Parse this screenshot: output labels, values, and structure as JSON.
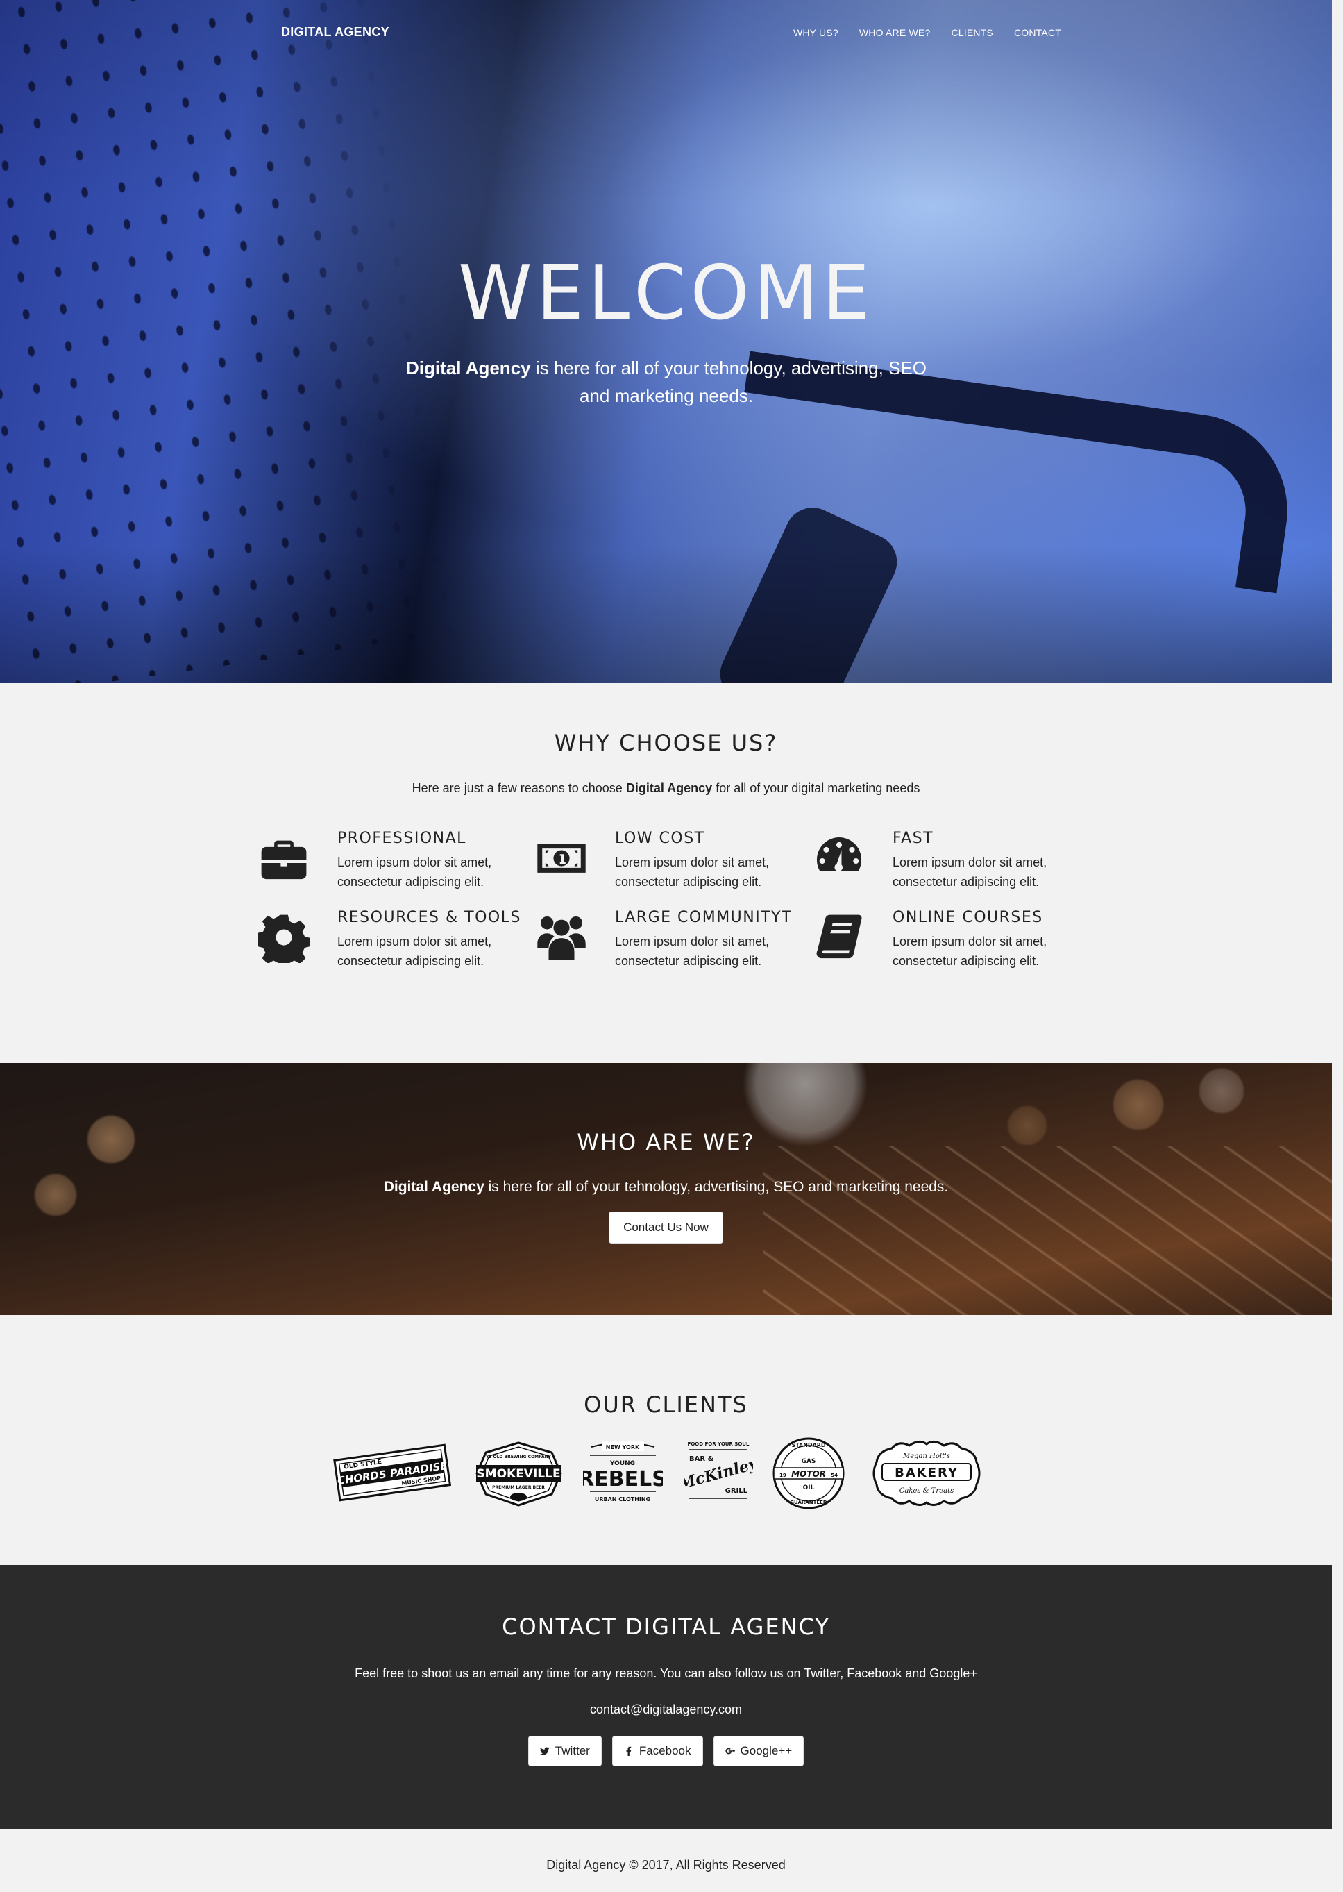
{
  "nav": {
    "brand": "DIGITAL AGENCY",
    "links": [
      "WHY US?",
      "WHO ARE WE?",
      "CLIENTS",
      "CONTACT"
    ]
  },
  "hero": {
    "title": "WELCOME",
    "text_bold": "Digital Agency",
    "text_rest": " is here for all of your tehnology, advertising, SEO and marketing needs."
  },
  "why": {
    "title": "WHY CHOOSE US?",
    "intro_pre": "Here are just a few reasons to choose ",
    "intro_bold": "Digital Agency",
    "intro_post": " for all of your digital marketing needs",
    "features": [
      {
        "icon": "briefcase-icon",
        "title": "PROFESSIONAL",
        "desc": "Lorem ipsum dolor sit amet, consectetur adipiscing elit."
      },
      {
        "icon": "money-icon",
        "title": "LOW COST",
        "desc": "Lorem ipsum dolor sit amet, consectetur adipiscing elit."
      },
      {
        "icon": "dashboard-icon",
        "title": "FAST",
        "desc": "Lorem ipsum dolor sit amet, consectetur adipiscing elit."
      },
      {
        "icon": "gear-icon",
        "title": "RESOURCES & TOOLS",
        "desc": "Lorem ipsum dolor sit amet, consectetur adipiscing elit."
      },
      {
        "icon": "users-icon",
        "title": "LARGE COMMUNITYT",
        "desc": "Lorem ipsum dolor sit amet, consectetur adipiscing elit."
      },
      {
        "icon": "book-icon",
        "title": "ONLINE COURSES",
        "desc": "Lorem ipsum dolor sit amet, consectetur adipiscing elit."
      }
    ]
  },
  "who": {
    "title": "WHO ARE WE?",
    "text_bold": "Digital Agency",
    "text_rest": " is here for all of your tehnology, advertising, SEO and marketing needs.",
    "button": "Contact Us Now"
  },
  "clients": {
    "title": "OUR CLIENTS",
    "logos": [
      {
        "name": "chords-paradise",
        "top": "OLD STYLE",
        "main": "CHORDS PARADISE",
        "sub": "MUSIC SHOP"
      },
      {
        "name": "smokeville",
        "top": "YE OLD BREWING COMPANY",
        "main": "SMOKEVILLE",
        "sub": "PREMIUM LAGER BEER"
      },
      {
        "name": "young-rebels",
        "top": "NEW YORK",
        "mid": "YOUNG",
        "main": "REBELS",
        "sub": "URBAN CLOTHING"
      },
      {
        "name": "mckinley",
        "top": "FOOD FOR YOUR SOUL",
        "pre": "BAR &",
        "main": "McKinley",
        "sub": "GRILL"
      },
      {
        "name": "motor-oil",
        "top": "STANDARD",
        "a": "GAS",
        "main": "MOTOR",
        "b": "OIL",
        "left": "19",
        "right": "54",
        "sub": "GUARANTEED"
      },
      {
        "name": "bakery",
        "top": "Megan Holt's",
        "main": "BAKERY",
        "sub": "Cakes & Treats"
      }
    ]
  },
  "contact": {
    "title": "CONTACT DIGITAL AGENCY",
    "text": "Feel free to shoot us an email any time for any reason. You can also follow us on Twitter, Facebook and Google+",
    "email": "contact@digitalagency.com",
    "social": [
      {
        "icon": "twitter-icon",
        "label": "Twitter"
      },
      {
        "icon": "facebook-icon",
        "label": "Facebook"
      },
      {
        "icon": "google-plus-icon",
        "label": "Google++"
      }
    ]
  },
  "footer": {
    "text": "Digital Agency © 2017, All Rights Reserved"
  }
}
